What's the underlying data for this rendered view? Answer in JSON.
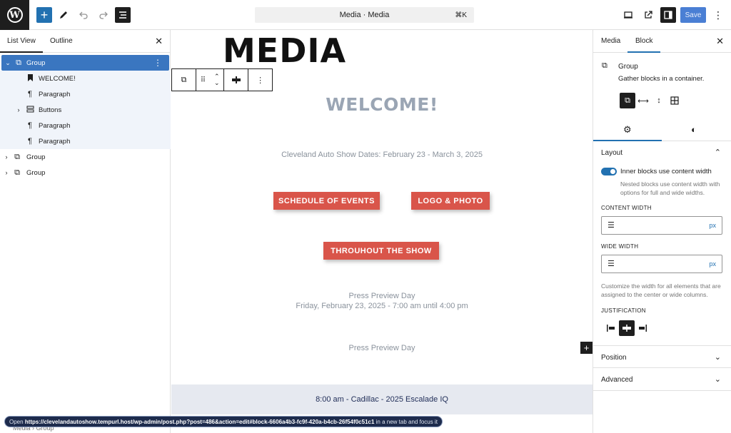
{
  "topbar": {
    "add_label": "+",
    "command_bar": {
      "title": "Media · Media",
      "shortcut": "⌘K"
    },
    "save_label": "Save",
    "more_label": "⋮"
  },
  "left_panel": {
    "tabs": [
      {
        "label": "List View"
      },
      {
        "label": "Outline"
      }
    ],
    "close_label": "✕",
    "tree": [
      {
        "label": "Group",
        "icon": "group-icon",
        "selected": true,
        "expanded": true
      },
      {
        "label": "WELCOME!",
        "icon": "bookmark-icon"
      },
      {
        "label": "Paragraph",
        "icon": "paragraph-icon"
      },
      {
        "label": "Buttons",
        "icon": "buttons-icon",
        "collapsed": true
      },
      {
        "label": "Paragraph",
        "icon": "paragraph-icon"
      },
      {
        "label": "Paragraph",
        "icon": "paragraph-icon"
      },
      {
        "label": "Group",
        "icon": "group-icon",
        "collapsed": true
      },
      {
        "label": "Group",
        "icon": "group-icon",
        "collapsed": true
      }
    ]
  },
  "canvas": {
    "title": "MEDIA",
    "welcome": "WELCOME!",
    "dates": "Cleveland Auto Show Dates: February 23 - March 3, 2025",
    "buttons": [
      "SCHEDULE OF EVENTS",
      "LOGO & PHOTO",
      "THROUHOUT THE SHOW"
    ],
    "press_day_1": "Press Preview Day",
    "press_day_date": "Friday, February 23, 2025 - 7:00 am until 4:00 pm",
    "press_day_2": "Press Preview Day",
    "event_band": "8:00 am - Cadillac - 2025 Escalade IQ"
  },
  "right_panel": {
    "tabs": [
      {
        "label": "Media"
      },
      {
        "label": "Block"
      }
    ],
    "close_label": "✕",
    "block": {
      "name": "Group",
      "description": "Gather blocks in a container."
    },
    "layout": {
      "heading": "Layout",
      "toggle_label": "Inner blocks use content width",
      "toggle_on": true,
      "toggle_help": "Nested blocks use content width with options for full and wide widths.",
      "content_width_label": "CONTENT WIDTH",
      "content_width_unit": "px",
      "wide_width_label": "WIDE WIDTH",
      "wide_width_unit": "px",
      "width_help": "Customize the width for all elements that are assigned to the center or wide columns.",
      "justification_label": "JUSTIFICATION"
    },
    "position_label": "Position",
    "advanced_label": "Advanced"
  },
  "status": {
    "prefix": "Open",
    "url": "https://clevelandautoshow.tempurl.host/wp-admin/post.php?post=486&action=edit#block-6606a4b3-fc9f-420a-b4cb-26f54f0c51c1",
    "suffix": "in a new tab and focus it"
  },
  "breadcrumb": "Media  ›  Group",
  "colors": {
    "accent": "#2271b1",
    "button_red": "#d9554a",
    "dark": "#1e1e1e",
    "band": "#e6e9f0"
  }
}
